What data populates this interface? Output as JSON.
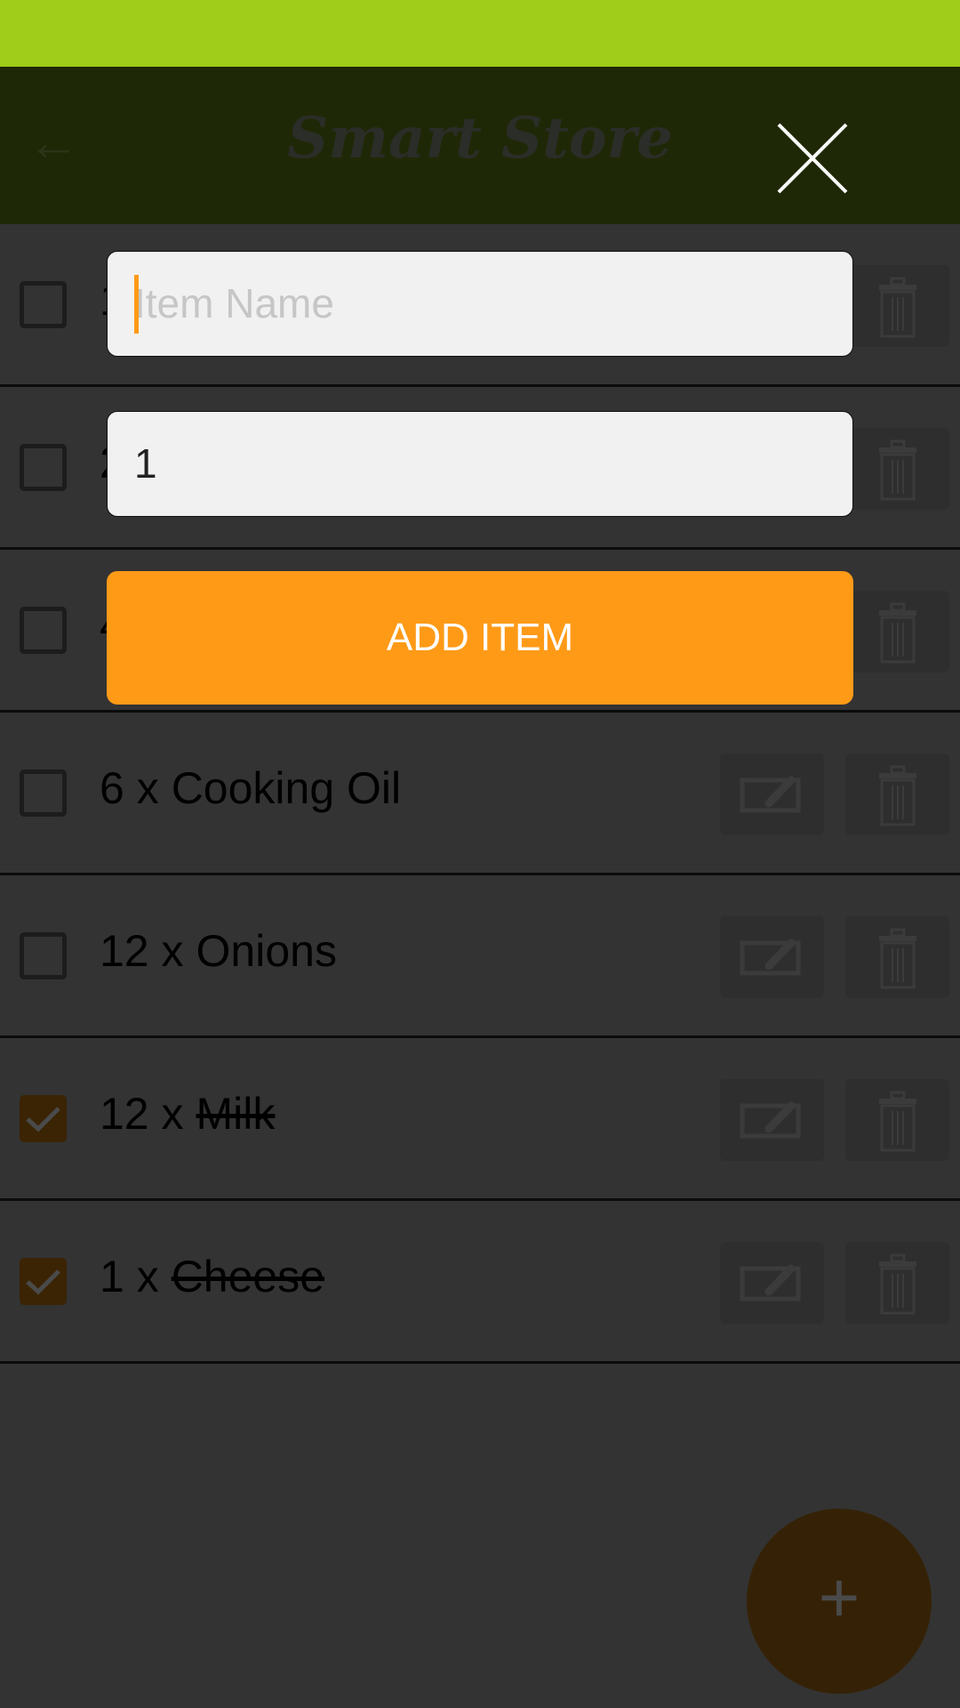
{
  "header": {
    "title": "Smart Store",
    "back_icon": "arrow-left-icon",
    "close_icon": "close-icon"
  },
  "list": [
    {
      "qty": "1",
      "name": "",
      "checked": false
    },
    {
      "qty": "2",
      "name": "",
      "checked": false
    },
    {
      "qty": "4",
      "name": "",
      "checked": false
    },
    {
      "qty": "6 x",
      "name": "Cooking Oil",
      "checked": false
    },
    {
      "qty": "12 x",
      "name": "Onions",
      "checked": false
    },
    {
      "qty": "12 x",
      "name": "Milk",
      "checked": true
    },
    {
      "qty": "1 x",
      "name": "Cheese",
      "checked": true
    }
  ],
  "dialog": {
    "name_placeholder": "Item Name",
    "name_value": "",
    "quantity_value": "1",
    "add_label": "ADD ITEM"
  },
  "fab": {
    "label": "+"
  },
  "colors": {
    "status": "#9fcd1a",
    "header": "#1f2806",
    "accent": "#ff9a17"
  }
}
